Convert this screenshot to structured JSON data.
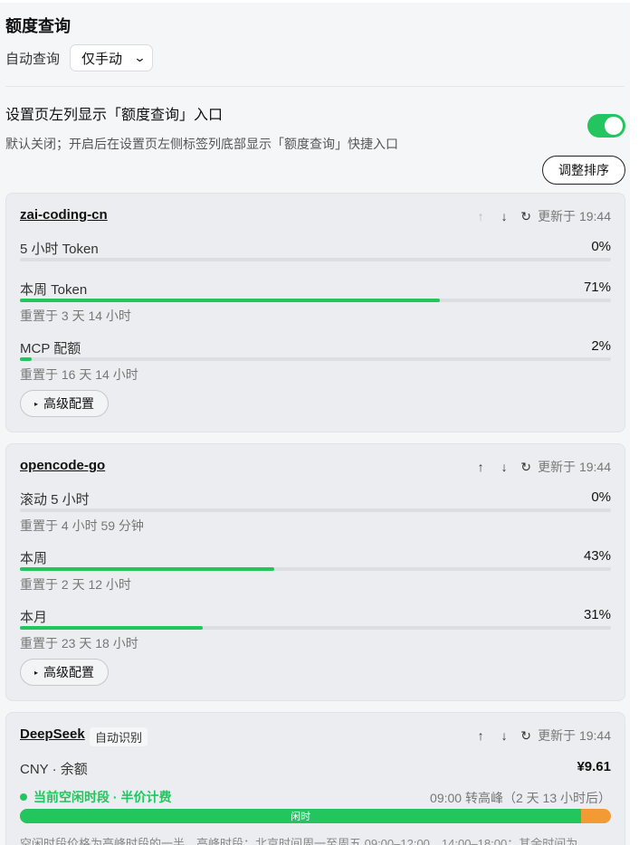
{
  "header": {
    "title": "额度查询",
    "auto_query_label": "自动查询",
    "auto_query_value": "仅手动"
  },
  "setting": {
    "title": "设置页左列显示「额度查询」入口",
    "desc": "默认关闭；开启后在设置页左侧标签列底部显示「额度查询」快捷入口",
    "toggle_on": true,
    "sort_button": "调整排序"
  },
  "icons": {
    "up": "↑",
    "down": "↓",
    "refresh": "↻",
    "chevron": "⌄",
    "triangle": "▸"
  },
  "cards": [
    {
      "name": "zai-coding-cn",
      "updated": "更新于 19:44",
      "metrics": [
        {
          "label": "5 小时 Token",
          "pct": "0%",
          "value": 0,
          "reset": ""
        },
        {
          "label": "本周 Token",
          "pct": "71%",
          "value": 71,
          "reset": "重置于 3 天 14 小时"
        },
        {
          "label": "MCP 配额",
          "pct": "2%",
          "value": 2,
          "reset": "重置于 16 天 14 小时"
        }
      ],
      "advanced": "高级配置"
    },
    {
      "name": "opencode-go",
      "updated": "更新于 19:44",
      "metrics": [
        {
          "label": "滚动 5 小时",
          "pct": "0%",
          "value": 0,
          "reset": "重置于 4 小时 59 分钟"
        },
        {
          "label": "本周",
          "pct": "43%",
          "value": 43,
          "reset": "重置于 2 天 12 小时"
        },
        {
          "label": "本月",
          "pct": "31%",
          "value": 31,
          "reset": "重置于 23 天 18 小时"
        }
      ],
      "advanced": "高级配置"
    },
    {
      "name": "DeepSeek",
      "tag": "自动识别",
      "updated": "更新于 19:44",
      "balance_label": "CNY · 余额",
      "balance_value": "¥9.61",
      "offpeak_label": "当前空闲时段 · 半价计费",
      "peak_note": "09:00 转高峰（2 天 13 小时后）",
      "offpeak_fraction": 0.95,
      "bar_label": "闲时",
      "footnote": "空闲时段价格为高峰时段的一半。高峰时段：北京时间周一至周五 09:00–12:00、14:00–18:00；其余时间为"
    }
  ]
}
